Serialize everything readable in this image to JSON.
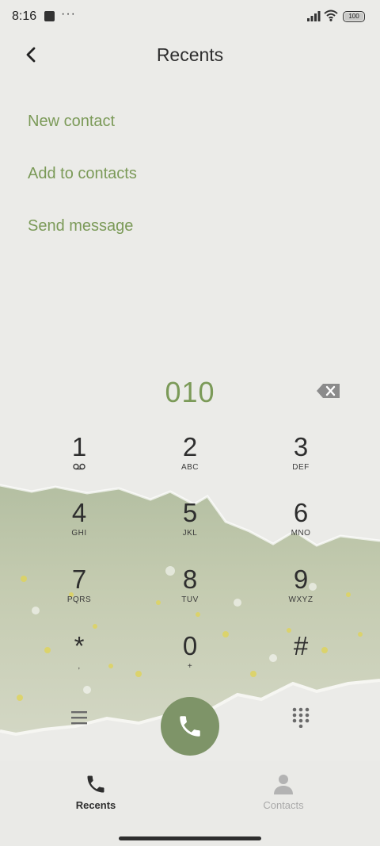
{
  "status_bar": {
    "time": "8:16",
    "overflow": "···",
    "battery": "100"
  },
  "header": {
    "title": "Recents"
  },
  "menu": {
    "new_contact": "New contact",
    "add_to_contacts": "Add to contacts",
    "send_message": "Send message"
  },
  "dialer": {
    "number": "010",
    "keys": [
      {
        "digit": "1",
        "letters": ""
      },
      {
        "digit": "2",
        "letters": "ABC"
      },
      {
        "digit": "3",
        "letters": "DEF"
      },
      {
        "digit": "4",
        "letters": "GHI"
      },
      {
        "digit": "5",
        "letters": "JKL"
      },
      {
        "digit": "6",
        "letters": "MNO"
      },
      {
        "digit": "7",
        "letters": "PQRS"
      },
      {
        "digit": "8",
        "letters": "TUV"
      },
      {
        "digit": "9",
        "letters": "WXYZ"
      },
      {
        "digit": "*",
        "letters": ","
      },
      {
        "digit": "0",
        "letters": "+"
      },
      {
        "digit": "#",
        "letters": ""
      }
    ]
  },
  "nav": {
    "recents": "Recents",
    "contacts": "Contacts"
  },
  "colors": {
    "accent": "#7b9a58",
    "call_button": "#7e9468",
    "background": "#ebebe8"
  },
  "icons": [
    "back-arrow-icon",
    "backspace-icon",
    "voicemail-icon",
    "menu-lines-icon",
    "phone-icon",
    "dialpad-icon",
    "person-icon"
  ]
}
